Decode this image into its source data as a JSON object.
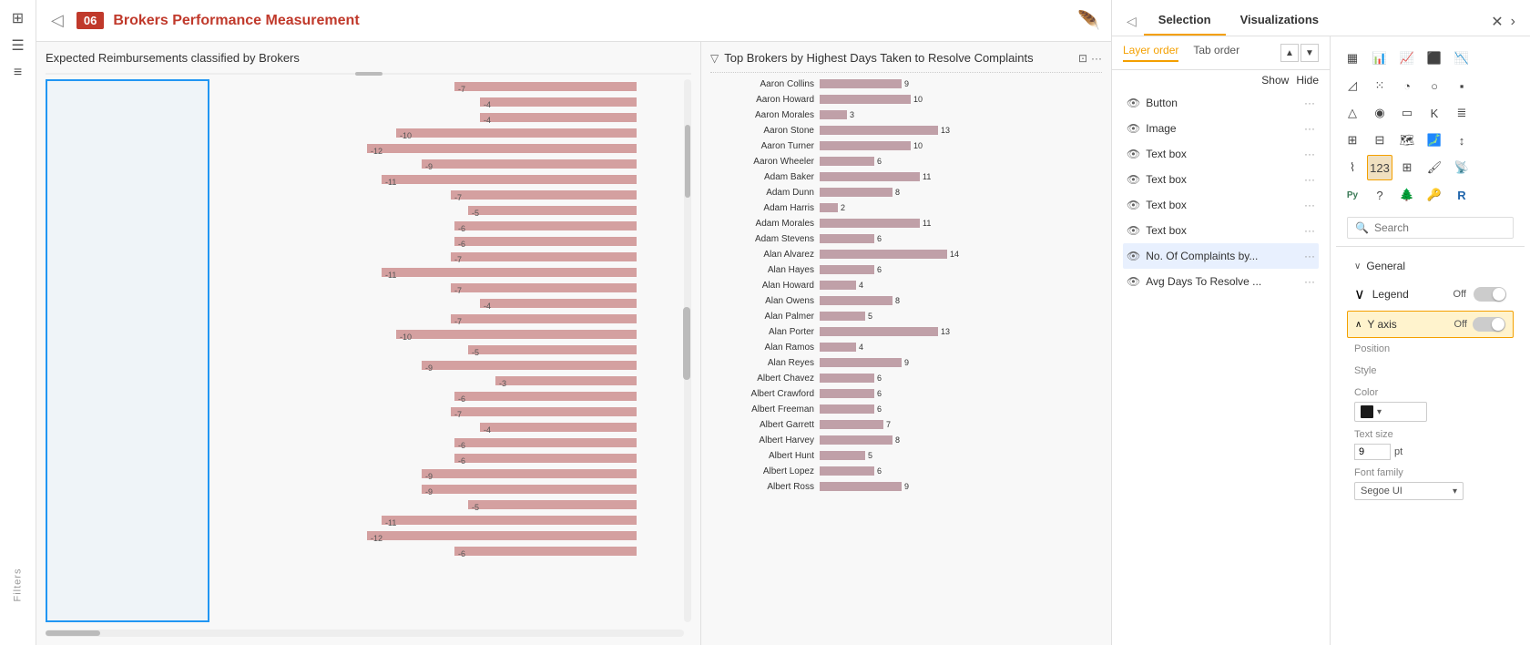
{
  "app": {
    "badge": "06",
    "title": "Brokers Performance Measurement",
    "back_icon": "◁"
  },
  "left_sidebar": {
    "icons": [
      {
        "name": "grid-icon",
        "glyph": "⊞"
      },
      {
        "name": "table-icon",
        "glyph": "☰"
      },
      {
        "name": "list-icon",
        "glyph": "≡"
      }
    ]
  },
  "filters_label": "Filters",
  "chart_left": {
    "title": "Expected Reimbursements classified by Brokers",
    "bars": [
      {
        "value": -7
      },
      {
        "value": -4
      },
      {
        "value": -4
      },
      {
        "value": -10
      },
      {
        "value": -12
      },
      {
        "value": -9
      },
      {
        "value": -11
      },
      {
        "value": -7
      },
      {
        "value": -5
      },
      {
        "value": -6
      },
      {
        "value": -6
      },
      {
        "value": -7
      },
      {
        "value": -11
      },
      {
        "value": -7
      },
      {
        "value": -4
      },
      {
        "value": -7
      },
      {
        "value": -10
      },
      {
        "value": -5
      },
      {
        "value": -9
      },
      {
        "value": -3
      },
      {
        "value": -6
      },
      {
        "value": -7
      },
      {
        "value": -4
      },
      {
        "value": -6
      },
      {
        "value": -6
      },
      {
        "value": -9
      },
      {
        "value": -9
      },
      {
        "value": -5
      },
      {
        "value": -11
      },
      {
        "value": -12
      },
      {
        "value": -6
      }
    ]
  },
  "chart_right": {
    "title": "Top Brokers by Highest Days Taken to Resolve Complaints",
    "brokers": [
      {
        "name": "Aaron Collins",
        "value": 9
      },
      {
        "name": "Aaron Howard",
        "value": 10
      },
      {
        "name": "Aaron Morales",
        "value": 3
      },
      {
        "name": "Aaron Stone",
        "value": 13
      },
      {
        "name": "Aaron Turner",
        "value": 10
      },
      {
        "name": "Aaron Wheeler",
        "value": 6
      },
      {
        "name": "Adam Baker",
        "value": 11
      },
      {
        "name": "Adam Dunn",
        "value": 8
      },
      {
        "name": "Adam Harris",
        "value": 2
      },
      {
        "name": "Adam Morales",
        "value": 11
      },
      {
        "name": "Adam Stevens",
        "value": 6
      },
      {
        "name": "Alan Alvarez",
        "value": 14
      },
      {
        "name": "Alan Hayes",
        "value": 6
      },
      {
        "name": "Alan Howard",
        "value": 4
      },
      {
        "name": "Alan Owens",
        "value": 8
      },
      {
        "name": "Alan Palmer",
        "value": 5
      },
      {
        "name": "Alan Porter",
        "value": 13
      },
      {
        "name": "Alan Ramos",
        "value": 4
      },
      {
        "name": "Alan Reyes",
        "value": 9
      },
      {
        "name": "Albert Chavez",
        "value": 6
      },
      {
        "name": "Albert Crawford",
        "value": 6
      },
      {
        "name": "Albert Freeman",
        "value": 6
      },
      {
        "name": "Albert Garrett",
        "value": 7
      },
      {
        "name": "Albert Harvey",
        "value": 8
      },
      {
        "name": "Albert Hunt",
        "value": 5
      },
      {
        "name": "Albert Lopez",
        "value": 6
      },
      {
        "name": "Albert Ross",
        "value": 9
      }
    ]
  },
  "panel": {
    "selection_tab": "Selection",
    "visualizations_tab": "Visualizations",
    "close_icon": "✕",
    "expand_icon": "›",
    "sub_tabs": {
      "layer_order": "Layer order",
      "tab_order": "Tab order"
    },
    "show_label": "Show",
    "hide_label": "Hide",
    "layers": [
      {
        "name": "Button",
        "has_eye": true,
        "has_dots": true
      },
      {
        "name": "Image",
        "has_eye": true,
        "has_dots": true
      },
      {
        "name": "Text box",
        "has_eye": true,
        "has_dots": true
      },
      {
        "name": "Text box",
        "has_eye": true,
        "has_dots": true
      },
      {
        "name": "Text box",
        "has_eye": true,
        "has_dots": true
      },
      {
        "name": "Text box",
        "has_eye": true,
        "has_dots": true
      },
      {
        "name": "No. Of Complaints by...",
        "has_eye": true,
        "has_dots": true,
        "selected": true
      },
      {
        "name": "Avg Days To Resolve ...",
        "has_eye": true,
        "has_dots": true
      }
    ],
    "search_placeholder": "Search",
    "format": {
      "general_label": "General",
      "legend_label": "Legend",
      "legend_value": "Off",
      "yaxis_label": "Y axis",
      "yaxis_value": "Off",
      "position_label": "Position",
      "style_label": "Style",
      "color_label": "Color",
      "text_size_label": "Text size",
      "text_size_value": "9",
      "text_size_unit": "pt",
      "font_family_label": "Font family",
      "font_family_value": "Segoe UI"
    }
  },
  "viz_icons": [
    {
      "name": "stacked-bar-icon",
      "glyph": "▦"
    },
    {
      "name": "bar-chart-icon",
      "glyph": "📊"
    },
    {
      "name": "line-chart-icon",
      "glyph": "📈"
    },
    {
      "name": "area-chart-icon",
      "glyph": "◿"
    },
    {
      "name": "scatter-icon",
      "glyph": "⁙"
    },
    {
      "name": "pie-chart-icon",
      "glyph": "◔"
    },
    {
      "name": "map-icon",
      "glyph": "🗺"
    },
    {
      "name": "filled-map-icon",
      "glyph": "🗾"
    },
    {
      "name": "funnel-icon",
      "glyph": "⬡"
    },
    {
      "name": "gauge-icon",
      "glyph": "◎"
    },
    {
      "name": "card-icon",
      "glyph": "▭"
    },
    {
      "name": "table-viz-icon",
      "glyph": "⊞"
    },
    {
      "name": "matrix-icon",
      "glyph": "⊟"
    },
    {
      "name": "treemap-icon",
      "glyph": "▪"
    },
    {
      "name": "waterfall-icon",
      "glyph": "↕"
    },
    {
      "name": "ribbon-icon",
      "glyph": "⌇"
    },
    {
      "name": "scatter-plot-icon",
      "glyph": "⋯"
    },
    {
      "name": "kpi-icon",
      "glyph": "K"
    },
    {
      "name": "slicer-icon",
      "glyph": "≣"
    },
    {
      "name": "r-visual-icon",
      "glyph": "R"
    },
    {
      "name": "python-icon",
      "glyph": "Py"
    },
    {
      "name": "qna-icon",
      "glyph": "?"
    },
    {
      "name": "decomp-icon",
      "glyph": "🌲"
    },
    {
      "name": "key-influencer-icon",
      "glyph": "🔑"
    }
  ]
}
